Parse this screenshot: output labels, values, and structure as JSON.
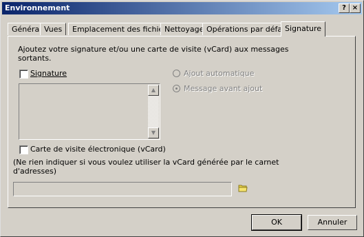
{
  "window": {
    "title": "Environnement",
    "help_label": "?",
    "close_label": "×"
  },
  "tabs": [
    {
      "label": "Général"
    },
    {
      "label": "Vues"
    },
    {
      "label": "Emplacement des fichiers"
    },
    {
      "label": "Nettoyage"
    },
    {
      "label": "Opérations par défaut"
    },
    {
      "label": "Signature",
      "active": true
    }
  ],
  "panel": {
    "intro_line1": "Ajoutez votre signature et/ou une carte de visite (vCard) aux messages",
    "intro_line2": "sortants.",
    "signature_label": "Signature",
    "radio_auto": "Ajout automatique",
    "radio_before_send": "Message avant ajout",
    "vcard_label": "Carte de visite électronique (vCard)",
    "vcard_note_line1": "(Ne rien indiquer si vous voulez utiliser la vCard générée par le carnet",
    "vcard_note_line2": "d'adresses)",
    "vcard_path_value": ""
  },
  "buttons": {
    "ok": "OK",
    "cancel": "Annuler"
  },
  "icons": [
    "help-icon",
    "close-icon",
    "scroll-up-icon",
    "scroll-down-icon",
    "folder-icon"
  ]
}
